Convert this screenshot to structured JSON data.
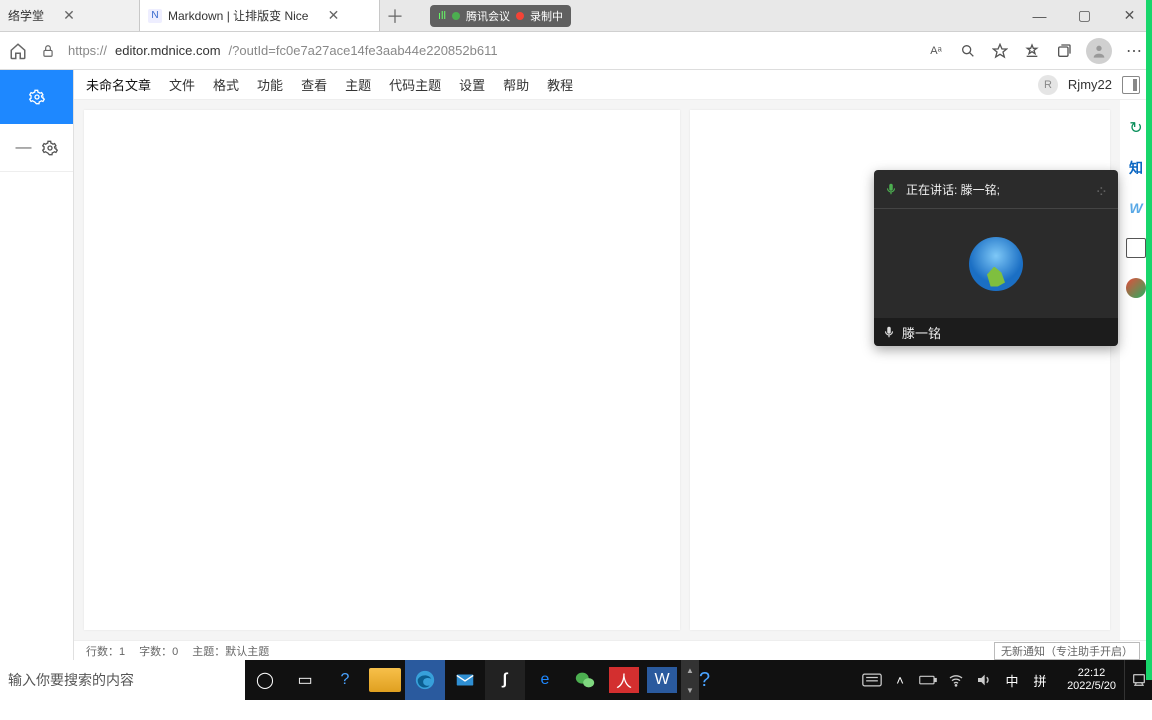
{
  "tabs": [
    {
      "title": "络学堂",
      "active": false
    },
    {
      "title": "Markdown | 让排版变 Nice",
      "active": true
    }
  ],
  "meeting_pill": {
    "app": "腾讯会议",
    "status": "录制中"
  },
  "window_controls": {
    "min": "—",
    "max": "▢",
    "close": "✕"
  },
  "address_bar": {
    "scheme": "https://",
    "host": "editor.mdnice.com",
    "path": "/?outId=fc0e7a27ace14fe3aab44e220852b611"
  },
  "app_menu": {
    "doc_title": "未命名文章",
    "items": [
      "文件",
      "格式",
      "功能",
      "查看",
      "主题",
      "代码主题",
      "设置",
      "帮助",
      "教程"
    ],
    "user_initial": "R",
    "username": "Rjmy22"
  },
  "right_icons": [
    "sync",
    "zhi",
    "w",
    "mon",
    "g"
  ],
  "right_icon_labels": {
    "zhi": "知",
    "w": "W"
  },
  "status": {
    "lines_label": "行数：",
    "lines": "1",
    "chars_label": "字数：",
    "chars": "0",
    "theme_label": "主题：",
    "theme": "默认主题",
    "notice": "无新通知（专注助手开启）"
  },
  "meeting_float": {
    "speaking_prefix": "正在讲话: ",
    "speaker": "滕一铭;",
    "footer_name": "滕一铭"
  },
  "taskbar": {
    "search_placeholder": "输入你要搜索的内容",
    "clock_time": "22:12",
    "clock_date": "2022/5/20",
    "ime": "中",
    "ime2": "拼"
  }
}
